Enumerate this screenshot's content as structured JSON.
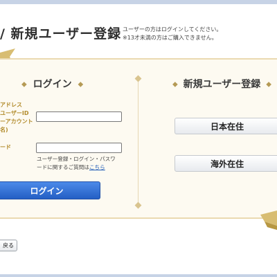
{
  "header": {
    "title": "/ 新規ユーザー登録",
    "note_line1": "ユーザーの方はログインしてください。",
    "note_line2": "※13才未満の方はご購入できません。"
  },
  "login": {
    "heading": "ログイン",
    "ornament": "◆",
    "label_line1": "アドレス",
    "label_line2": "ユーザーID",
    "label_line3": "ーアカウント",
    "label_line4": "名)",
    "password_label": "ード",
    "help_text": "ユーザー登録・ログイン・パスワードに関するご質問は",
    "help_link": "こちら",
    "button_label": "ログイン"
  },
  "register": {
    "heading": "新規ユーザー登録",
    "ornament": "◆",
    "japan_button": "日本在住",
    "overseas_button": "海外在住"
  },
  "footer": {
    "back_label": "戻る"
  },
  "colors": {
    "accent_gold": "#b28b2c",
    "primary_blue": "#2d6ed8",
    "panel_bg": "#fdfaf1"
  }
}
